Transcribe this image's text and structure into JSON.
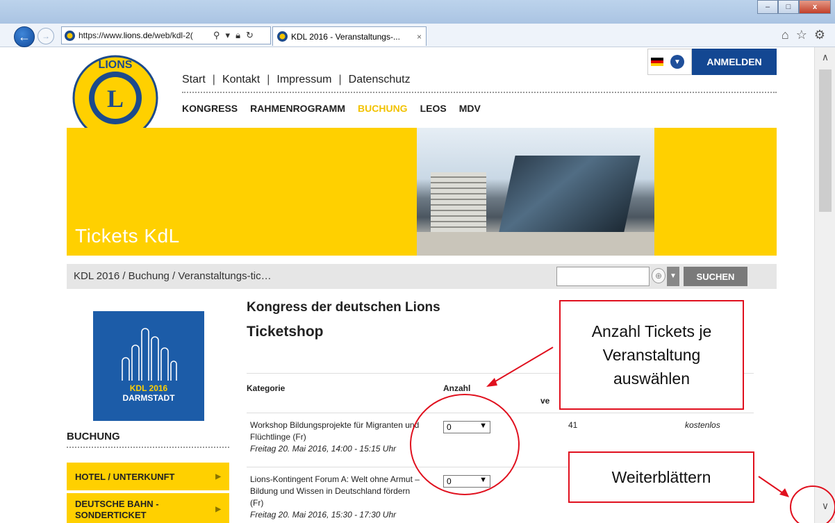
{
  "browser": {
    "url_prefix": "https://www.",
    "url_host": "lions.de",
    "url_rest": "/web/kdl-2(",
    "tab_title": "KDL 2016 - Veranstaltungs-...",
    "tab_close": "×",
    "win_minimize": "–",
    "win_maximize": "□",
    "win_close": "x",
    "icons": [
      "home-icon",
      "star-icon",
      "gear-icon"
    ]
  },
  "header": {
    "topnav": [
      "Start",
      "Kontakt",
      "Impressum",
      "Datenschutz"
    ],
    "topnav_sep": "|",
    "mainnav": [
      "KONGRESS",
      "RAHMENROGRAMM",
      "BUCHUNG",
      "LEOS",
      "MDV"
    ],
    "active_nav": "BUCHUNG",
    "login": "ANMELDEN"
  },
  "hero": {
    "title": "Tickets KdL"
  },
  "breadcrumb": "KDL 2016 / Buchung / Veranstaltungs-tic…",
  "search": {
    "button": "SUCHEN",
    "value": ""
  },
  "sidebar": {
    "badge_year": "KDL 2016",
    "badge_city": "DARMSTADT",
    "heading": "BUCHUNG",
    "items": [
      "HOTEL / UNTERKUNFT",
      "DEUTSCHE BAHN - SONDERTICKET"
    ]
  },
  "main": {
    "title": "Kongress der deutschen Lions",
    "subtitle": "Ticketshop",
    "col_category": "Kategorie",
    "col_amount": "Anzahl",
    "col_avail_partial": "ve",
    "rows": [
      {
        "name_line1": "Workshop Bildungsprojekte für Migranten und",
        "name_line2": "Flüchtlinge (Fr)",
        "date": "Freitag 20. Mai 2016, 14:00 - 15:15 Uhr",
        "qty": "0",
        "available": "41",
        "price": "kostenlos"
      },
      {
        "name_line1": "Lions-Kontingent Forum A: Welt ohne Armut –",
        "name_line2": "Bildung und Wissen in Deutschland fördern",
        "name_line3": "(Fr)",
        "date": "Freitag 20. Mai 2016, 15:30 - 17:30 Uhr",
        "qty": "0"
      }
    ]
  },
  "annotations": {
    "callout1": [
      "Anzahl Tickets je",
      "Veranstaltung",
      "auswählen"
    ],
    "callout2": "Weiterblättern",
    "color": "#e0101e"
  },
  "colors": {
    "brand_yellow": "#ffd000",
    "brand_blue": "#134792"
  }
}
